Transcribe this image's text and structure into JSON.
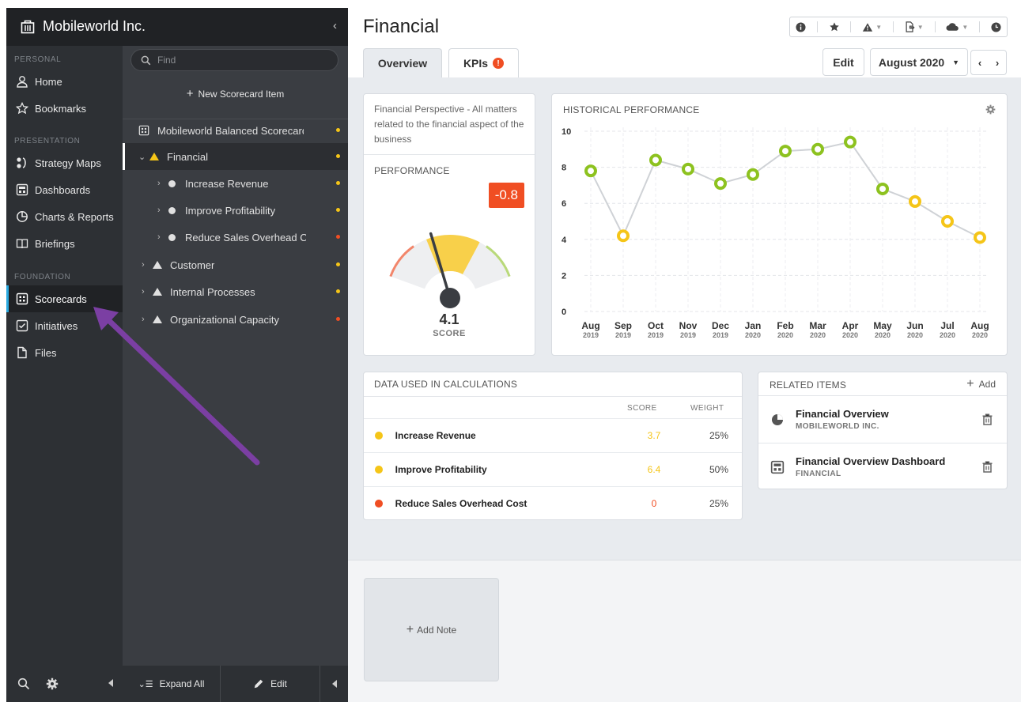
{
  "app": {
    "org_name": "Mobileworld Inc."
  },
  "nav": {
    "sections": {
      "personal": "PERSONAL",
      "presentation": "PRESENTATION",
      "foundation": "FOUNDATION"
    },
    "items": [
      {
        "label": "Home",
        "icon": "user-icon"
      },
      {
        "label": "Bookmarks",
        "icon": "star-icon"
      },
      {
        "label": "Strategy Maps",
        "icon": "strategy-map-icon"
      },
      {
        "label": "Dashboards",
        "icon": "dashboard-icon"
      },
      {
        "label": "Charts & Reports",
        "icon": "pie-chart-icon"
      },
      {
        "label": "Briefings",
        "icon": "book-icon"
      },
      {
        "label": "Scorecards",
        "icon": "scorecard-icon",
        "active": true
      },
      {
        "label": "Initiatives",
        "icon": "checkbox-icon"
      },
      {
        "label": "Files",
        "icon": "file-icon"
      }
    ]
  },
  "tree": {
    "search_placeholder": "Find",
    "new_item_label": "New Scorecard Item",
    "rows": [
      {
        "label": "Mobileworld Balanced Scorecard",
        "status": "#f5c518"
      },
      {
        "label": "Financial",
        "status": "#f5c518",
        "selected": true
      },
      {
        "label": "Increase Revenue",
        "status": "#f5c518"
      },
      {
        "label": "Improve Profitability",
        "status": "#f5c518"
      },
      {
        "label": "Reduce Sales Overhead Cost",
        "status": "#f04e23"
      },
      {
        "label": "Customer",
        "status": "#f5c518"
      },
      {
        "label": "Internal Processes",
        "status": "#f5c518"
      },
      {
        "label": "Organizational Capacity",
        "status": "#f04e23"
      }
    ],
    "expand_all_label": "Expand All",
    "edit_label": "Edit"
  },
  "page": {
    "title": "Financial",
    "tabs": [
      {
        "label": "Overview",
        "active": true
      },
      {
        "label": "KPIs",
        "alert": "!"
      }
    ],
    "edit_label": "Edit",
    "period": "August 2020"
  },
  "performance": {
    "description": "Financial Perspective - All matters related to the financial aspect of the business",
    "title": "PERFORMANCE",
    "delta": "-0.8",
    "score": "4.1",
    "score_label": "SCORE",
    "score_value": 4.1,
    "scale_max": 10
  },
  "history": {
    "title": "HISTORICAL PERFORMANCE"
  },
  "chart_data": {
    "type": "line",
    "title": "HISTORICAL PERFORMANCE",
    "categories": [
      [
        "Aug",
        "2019"
      ],
      [
        "Sep",
        "2019"
      ],
      [
        "Oct",
        "2019"
      ],
      [
        "Nov",
        "2019"
      ],
      [
        "Dec",
        "2019"
      ],
      [
        "Jan",
        "2020"
      ],
      [
        "Feb",
        "2020"
      ],
      [
        "Mar",
        "2020"
      ],
      [
        "Apr",
        "2020"
      ],
      [
        "May",
        "2020"
      ],
      [
        "Jun",
        "2020"
      ],
      [
        "Jul",
        "2020"
      ],
      [
        "Aug",
        "2020"
      ]
    ],
    "values": [
      7.8,
      4.2,
      8.4,
      7.9,
      7.1,
      7.6,
      8.9,
      9.0,
      9.4,
      6.8,
      6.1,
      5.0,
      4.1
    ],
    "point_colors": [
      "#8dc21f",
      "#f5c518",
      "#8dc21f",
      "#8dc21f",
      "#8dc21f",
      "#8dc21f",
      "#8dc21f",
      "#8dc21f",
      "#8dc21f",
      "#8dc21f",
      "#f5c518",
      "#f5c518",
      "#f5c518"
    ],
    "ylim": [
      0,
      10
    ],
    "yticks": [
      0,
      2,
      4,
      6,
      8,
      10
    ],
    "grid": true
  },
  "data_calc": {
    "title": "DATA USED IN CALCULATIONS",
    "col_score": "SCORE",
    "col_weight": "WEIGHT",
    "rows": [
      {
        "name": "Increase Revenue",
        "score": "3.7",
        "weight": "25%",
        "color": "#f5c518"
      },
      {
        "name": "Improve Profitability",
        "score": "6.4",
        "weight": "50%",
        "color": "#f5c518"
      },
      {
        "name": "Reduce Sales Overhead Cost",
        "score": "0",
        "weight": "25%",
        "color": "#f04e23"
      }
    ]
  },
  "related": {
    "title": "RELATED ITEMS",
    "add_label": "Add",
    "items": [
      {
        "title": "Financial Overview",
        "subtitle": "MOBILEWORLD INC.",
        "icon": "pie-chart-icon"
      },
      {
        "title": "Financial Overview Dashboard",
        "subtitle": "FINANCIAL",
        "icon": "dashboard-icon"
      }
    ]
  },
  "notes": {
    "add_label": "Add Note"
  }
}
